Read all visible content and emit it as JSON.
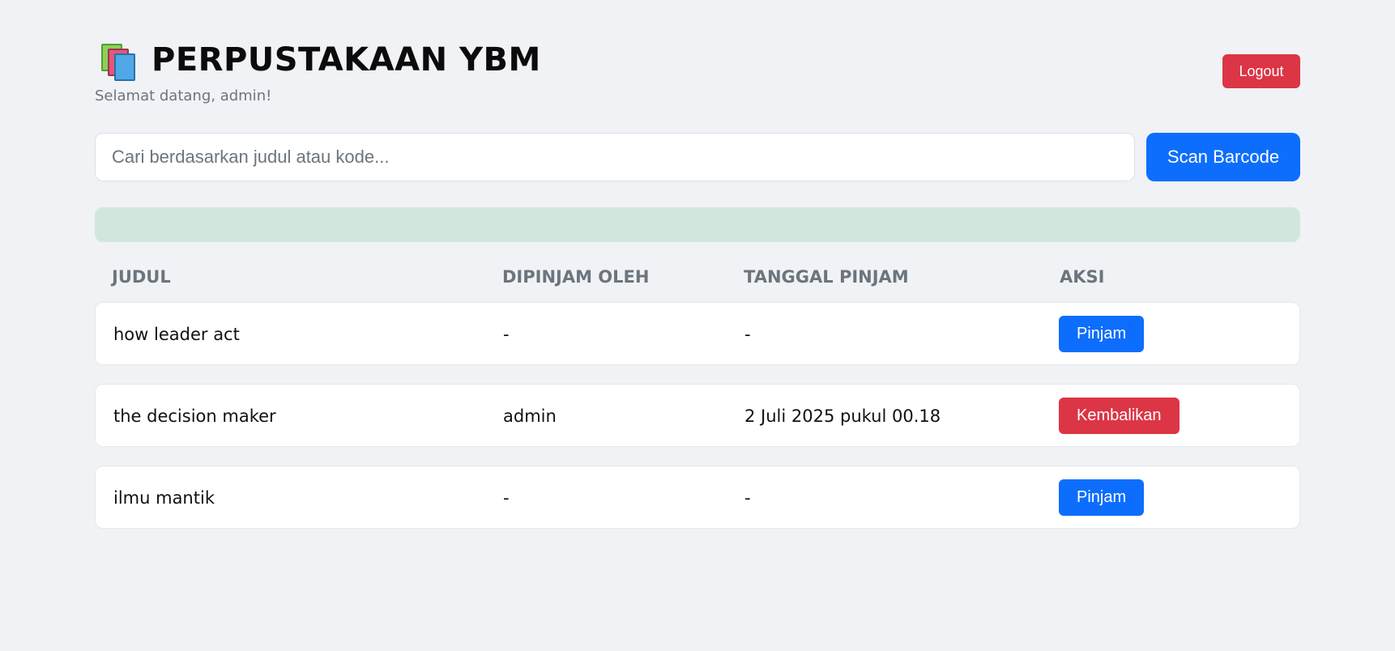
{
  "header": {
    "icon": "books-icon",
    "title": "PERPUSTAKAAN YBM",
    "welcome": "Selamat datang, admin!",
    "logout_label": "Logout"
  },
  "search": {
    "placeholder": "Cari berdasarkan judul atau kode...",
    "value": "",
    "scan_label": "Scan Barcode"
  },
  "alert": {
    "text": "",
    "color": "#d1e7dd"
  },
  "table": {
    "headers": [
      "JUDUL",
      "DIPINJAM OLEH",
      "TANGGAL PINJAM",
      "AKSI"
    ],
    "rows": [
      {
        "judul": "how leader act",
        "dipinjam_oleh": "-",
        "tanggal_pinjam": "-",
        "aksi": "Pinjam",
        "aksi_type": "pinjam"
      },
      {
        "judul": "the decision maker",
        "dipinjam_oleh": "admin",
        "tanggal_pinjam": "2 Juli 2025 pukul 00.18",
        "aksi": "Kembalikan",
        "aksi_type": "kembalikan"
      },
      {
        "judul": "ilmu mantik",
        "dipinjam_oleh": "-",
        "tanggal_pinjam": "-",
        "aksi": "Pinjam",
        "aksi_type": "pinjam"
      }
    ]
  },
  "colors": {
    "primary": "#0d6efd",
    "danger": "#dc3545",
    "background": "#f0f2f5"
  }
}
